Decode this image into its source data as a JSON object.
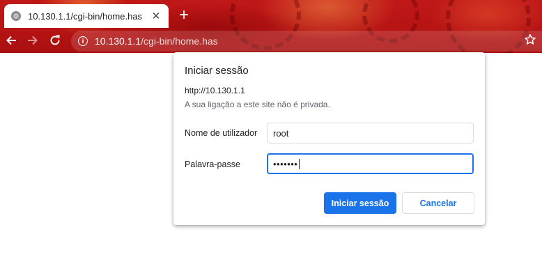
{
  "tab": {
    "title": "10.130.1.1/cgi-bin/home.has",
    "favicon_icon": "globe-icon",
    "close_icon": "close-icon",
    "close_glyph": "✕"
  },
  "toolbar": {
    "new_tab_glyph": "+",
    "back_glyph": "🡐",
    "forward_glyph": "🡒",
    "reload_glyph": "⟳",
    "info_glyph": "i",
    "bookmark_glyph": "☆",
    "url_host": "10.130.1.1",
    "url_path": "/cgi-bin/home.has"
  },
  "dialog": {
    "title": "Iniciar sessão",
    "host": "http://10.130.1.1",
    "warning": "A sua ligação a este site não é privada.",
    "username_label": "Nome de utilizador",
    "username_value": "root",
    "password_label": "Palavra-passe",
    "password_value": "•••••••",
    "login_button": "Iniciar sessão",
    "cancel_button": "Cancelar"
  },
  "colors": {
    "chrome_red": "#b81414",
    "accent_blue": "#1a73e8"
  }
}
